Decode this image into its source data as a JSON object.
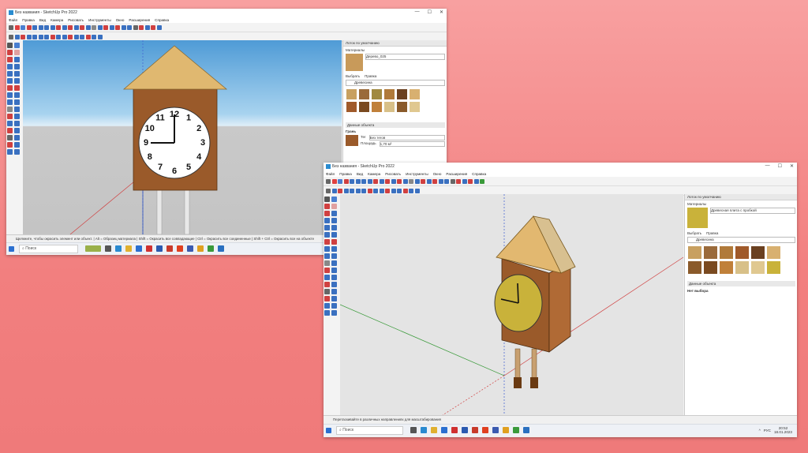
{
  "window1": {
    "title": "Без названия - SketchUp Pro 2022",
    "menu": [
      "Файл",
      "Правка",
      "Вид",
      "Камера",
      "Рисовать",
      "Инструменты",
      "Окно",
      "Расширения",
      "Справка"
    ],
    "tray_title": "Лоток по умолчанию",
    "materials_header": "Материалы",
    "material_name": "Дерево_025",
    "tab_select": "Выбрать",
    "tab_edit": "Правка",
    "category": "Древесина",
    "entity_header": "Данные объекта",
    "entity_type": "Грань",
    "layer_label": "Тег",
    "layer_value": "Без тегов",
    "area_label": "Площадь",
    "area_value": "1,70 м²",
    "status_text": "Щелкните, чтобы окрасить элемент или объект. | Alt = Образец материала | Shift = Окрасить все совпадающие | Ctrl = Окрасить все соединенные | Shift + Ctrl = Окрасить все на объекте",
    "search_label": "Поиск",
    "clock_numbers": [
      "12",
      "1",
      "2",
      "3",
      "4",
      "5",
      "6",
      "7",
      "8",
      "9",
      "10",
      "11"
    ]
  },
  "window2": {
    "title": "Без названия - SketchUp Pro 2022",
    "menu": [
      "Файл",
      "Правка",
      "Вид",
      "Камера",
      "Рисовать",
      "Инструменты",
      "Окно",
      "Расширения",
      "Справка"
    ],
    "tray_title": "Лоток по умолчанию",
    "materials_header": "Материалы",
    "material_name": "Древесная плита с пробкой",
    "tab_select": "Выбрать",
    "tab_edit": "Правка",
    "category": "Древесина",
    "entity_header": "Данные объекта",
    "entity_type": "Нет выбора",
    "status_text": "Перетаскивайте в различных направлениях для масштабирования",
    "search_label": "Поиск",
    "time": "20:52",
    "date": "18.01.2023",
    "lang": "РУС"
  },
  "colors": {
    "background": "#f27f7f",
    "sky_top": "#5aa8dc",
    "ground": "#c8c8c8",
    "wood": "#9a5a2a",
    "roof": "#e0b870",
    "clock_face2": "#c9b23a"
  }
}
